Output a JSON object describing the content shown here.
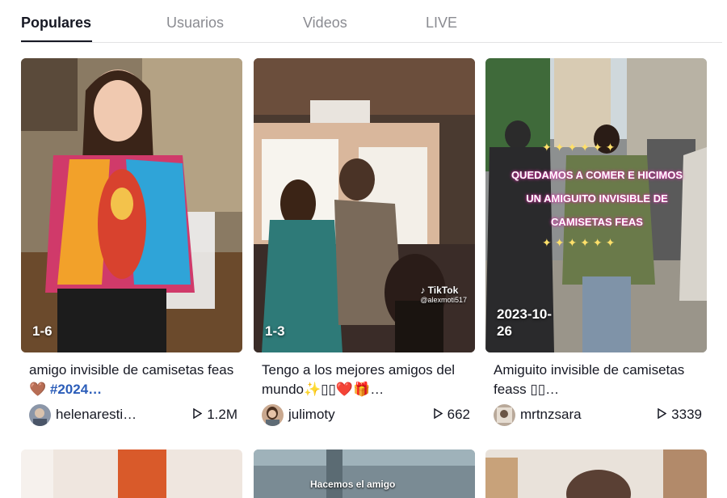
{
  "tabs": [
    {
      "label": "Populares",
      "active": true
    },
    {
      "label": "Usuarios",
      "active": false
    },
    {
      "label": "Videos",
      "active": false
    },
    {
      "label": "LIVE",
      "active": false
    }
  ],
  "cards": [
    {
      "badge": "1-6",
      "caption_text": "amigo invisible de camisetas feas🤎 ",
      "caption_tag": "#2024…",
      "username": "helenaresti…",
      "views": "1.2M"
    },
    {
      "badge": "1-3",
      "caption_text": "Tengo a los mejores amigos del mundo✨▯▯❤️🎁…",
      "username": "julimoty",
      "views": "662",
      "watermark_brand": "TikTok",
      "watermark_user": "@alexmoti517"
    },
    {
      "badge_line1": "2023-10-",
      "badge_line2": "26",
      "caption_text": "Amiguito invisible de camisetas feass ▯▯…",
      "username": "mrtnzsara",
      "views": "3339",
      "overlay_text": "QUEDAMOS A COMER E HICIMOS UN AMIGUITO INVISIBLE DE CAMISETAS FEAS",
      "overlay_bottom": "Hacemos el amigo"
    }
  ],
  "icons": {
    "play": "play-icon",
    "tiktok": "tiktok-logo-icon"
  },
  "colors": {
    "accent_tag": "#2b5db9",
    "text": "#161823",
    "muted": "#8a8b91"
  }
}
